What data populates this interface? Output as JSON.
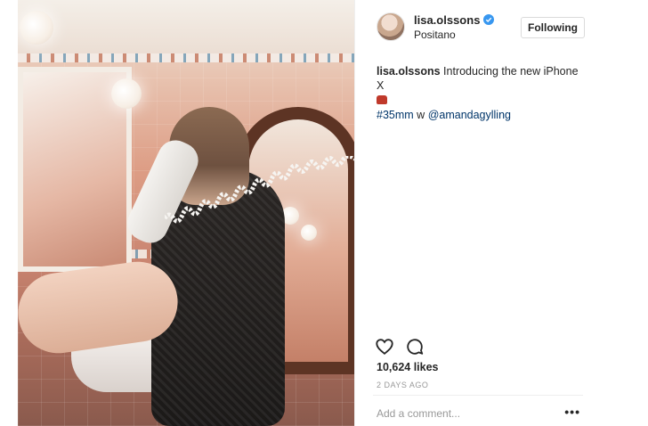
{
  "post": {
    "image_alt": "",
    "author": {
      "username": "lisa.olssons",
      "verified": true,
      "location": "Positano"
    },
    "follow_button_label": "Following",
    "caption": {
      "username": "lisa.olssons",
      "text": "Introducing the new iPhone X",
      "emoji_icon": "telephone-emoji",
      "hashtag": "#35mm",
      "connector": "w",
      "mention": "@amandagylling"
    },
    "likes_text": "10,624 likes",
    "timestamp": "2 DAYS AGO",
    "comment_placeholder": "Add a comment...",
    "more_label": "•••",
    "icons": {
      "like": "heart-icon",
      "comment": "comment-icon",
      "verified": "verified-badge-icon",
      "more": "more-options-icon"
    },
    "colors": {
      "link": "#003569",
      "verified": "#3897f0",
      "muted": "#999999",
      "text": "#262626"
    }
  }
}
